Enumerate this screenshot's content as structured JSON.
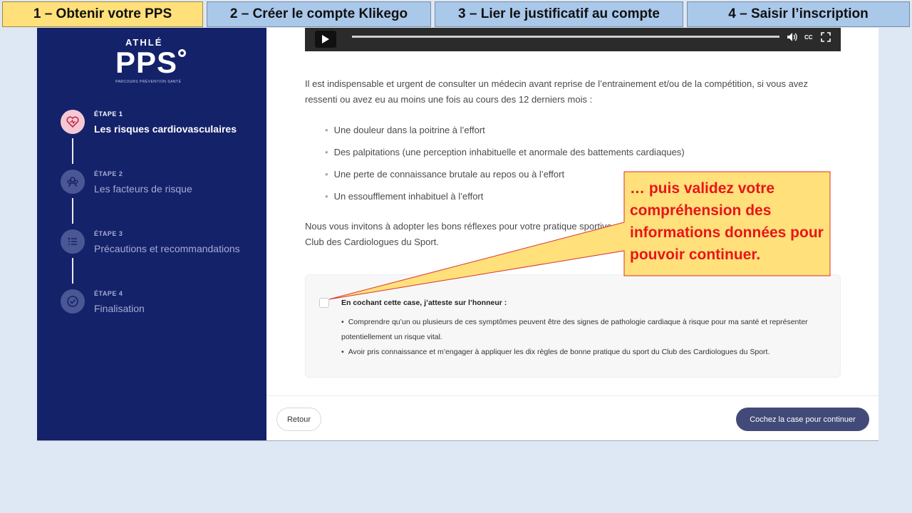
{
  "tabs": [
    {
      "label": "1 – Obtenir votre PPS"
    },
    {
      "label": "2 – Créer le compte Klikego"
    },
    {
      "label": "3 – Lier le justificatif au compte"
    },
    {
      "label": "4 – Saisir l’inscription"
    }
  ],
  "logo": {
    "small": "ATHLÉ",
    "big": "PPS",
    "sub": "PARCOURS PRÉVENTION SANTÉ"
  },
  "steps": [
    {
      "label": "ÉTAPE 1",
      "title": "Les risques cardiovasculaires",
      "icon": "heart-icon"
    },
    {
      "label": "ÉTAPE 2",
      "title": "Les facteurs de risque",
      "icon": "people-icon"
    },
    {
      "label": "ÉTAPE 3",
      "title": "Précautions et recommandations",
      "icon": "list-icon"
    },
    {
      "label": "ÉTAPE 4",
      "title": "Finalisation",
      "icon": "check-icon"
    }
  ],
  "video": {
    "cc": "CC"
  },
  "content": {
    "intro": "Il est indispensable et urgent de consulter un médecin avant reprise de l’entrainement et/ou de la compétition, si vous avez ressenti ou avez eu au moins une fois au cours des 12 derniers mois :",
    "bullets": [
      "Une douleur dans la poitrine à l’effort",
      "Des palpitations (une perception inhabituelle et anormale des battements cardiaques)",
      "Une perte de connaissance brutale au repos ou à l’effort",
      "Un essoufflement inhabituel à l’effort"
    ],
    "invite_line1": "Nous vous invitons à adopter les bons réflexes pour votre pratique sportive",
    "invite_line2": "Club des Cardiologues du Sport."
  },
  "attest": {
    "title": "En cochant cette case, j’atteste sur l’honneur :",
    "items": [
      "Comprendre qu’un ou plusieurs de ces symptômes peuvent être des signes de pathologie cardiaque à risque pour ma santé et représenter potentiellement un risque vital.",
      "Avoir pris connaissance et m’engager à appliquer les dix règles de bonne pratique du sport du Club des Cardiologues du Sport."
    ]
  },
  "footer": {
    "back": "Retour",
    "continue": "Cochez la case pour continuer"
  },
  "callout": {
    "text": "… puis validez votre compréhension des informations données pour pouvoir continuer."
  },
  "colors": {
    "sidebar": "#14226a",
    "callout_fill": "#ffe07a",
    "callout_text": "#e8151b",
    "button": "#414a78"
  }
}
